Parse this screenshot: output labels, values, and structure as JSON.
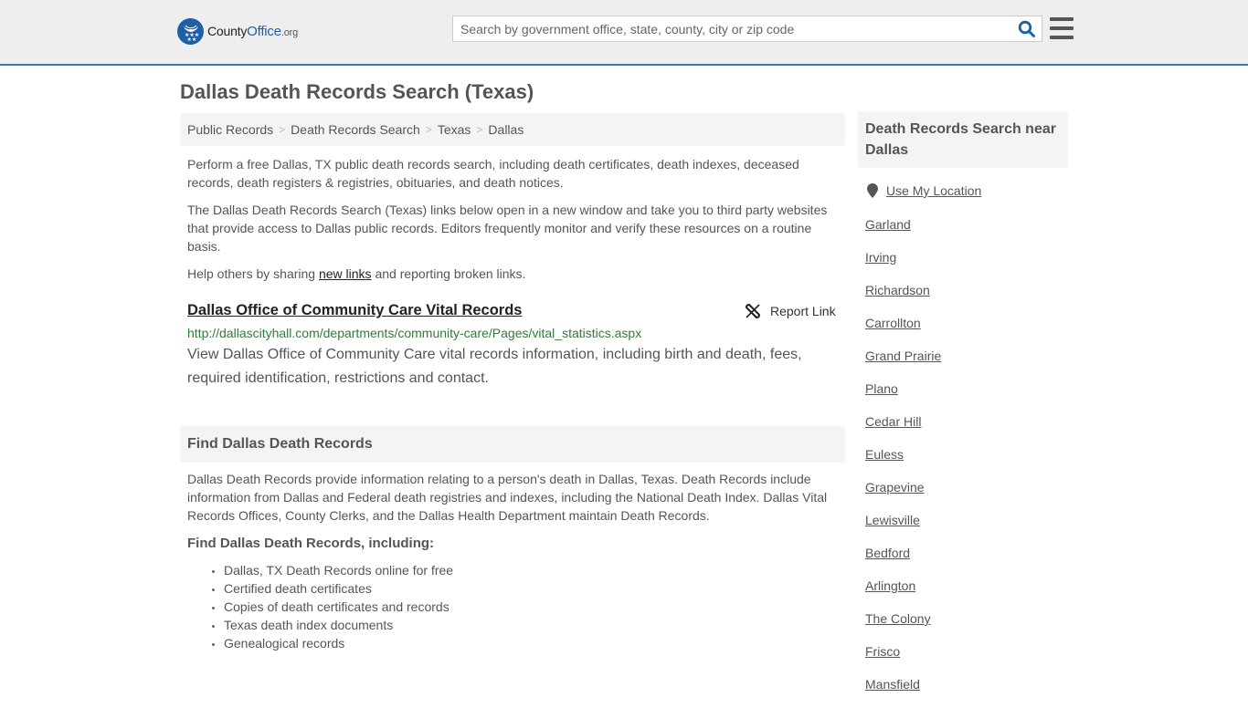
{
  "header": {
    "logo": {
      "name": "County",
      "accent": "Office",
      "tld": ".org"
    },
    "search": {
      "placeholder": "Search by government office, state, county, city or zip code",
      "value": ""
    },
    "colors": {
      "brand": "#1f5fa6",
      "header_border": "#3478b4",
      "header_bg": "#eeeeee"
    }
  },
  "page": {
    "title": "Dallas Death Records Search (Texas)",
    "breadcrumb": [
      "Public Records",
      "Death Records Search",
      "Texas",
      "Dallas"
    ],
    "intro": [
      "Perform a free Dallas, TX public death records search, including death certificates, death indexes, deceased records, death registers & registries, obituaries, and death notices.",
      "The Dallas Death Records Search (Texas) links below open in a new window and take you to third party websites that provide access to Dallas public records. Editors frequently monitor and verify these resources on a routine basis."
    ],
    "help": {
      "prefix": "Help others by sharing ",
      "link": "new links",
      "suffix": " and reporting broken links."
    }
  },
  "listing": {
    "title": "Dallas Office of Community Care Vital Records",
    "report_label": "Report Link",
    "url": "http://dallascityhall.com/departments/community-care/Pages/vital_statistics.aspx",
    "url_color": "#2e7d32",
    "description": "View Dallas Office of Community Care vital records information, including birth and death, fees, required identification, restrictions and contact."
  },
  "find_section": {
    "heading": "Find Dallas Death Records",
    "body": "Dallas Death Records provide information relating to a person's death in Dallas, Texas. Death Records include information from Dallas and Federal death registries and indexes, including the National Death Index. Dallas Vital Records Offices, County Clerks, and the Dallas Health Department maintain Death Records.",
    "subheading": "Find Dallas Death Records, including:",
    "items": [
      "Dallas, TX Death Records online for free",
      "Certified death certificates",
      "Copies of death certificates and records",
      "Texas death index documents",
      "Genealogical records"
    ]
  },
  "sidebar": {
    "heading": "Death Records Search near Dallas",
    "use_location": "Use My Location",
    "cities": [
      "Garland",
      "Irving",
      "Richardson",
      "Carrollton",
      "Grand Prairie",
      "Plano",
      "Cedar Hill",
      "Euless",
      "Grapevine",
      "Lewisville",
      "Bedford",
      "Arlington",
      "The Colony",
      "Frisco",
      "Mansfield"
    ]
  }
}
